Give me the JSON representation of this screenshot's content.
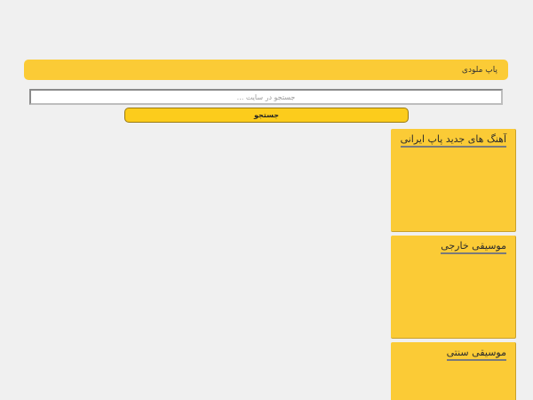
{
  "header": {
    "site_title": "پاپ ملودی"
  },
  "search": {
    "placeholder": "جستجو در سایت ...",
    "button_label": "جستجو"
  },
  "categories": [
    {
      "title": "آهنگ های جدید پاپ ایرانی"
    },
    {
      "title": "موسیقی خارجی"
    },
    {
      "title": "موسیقی سنتی"
    }
  ],
  "colors": {
    "background": "#f0f0f0",
    "accent": "#fbcb36",
    "button": "#fccc1c"
  }
}
